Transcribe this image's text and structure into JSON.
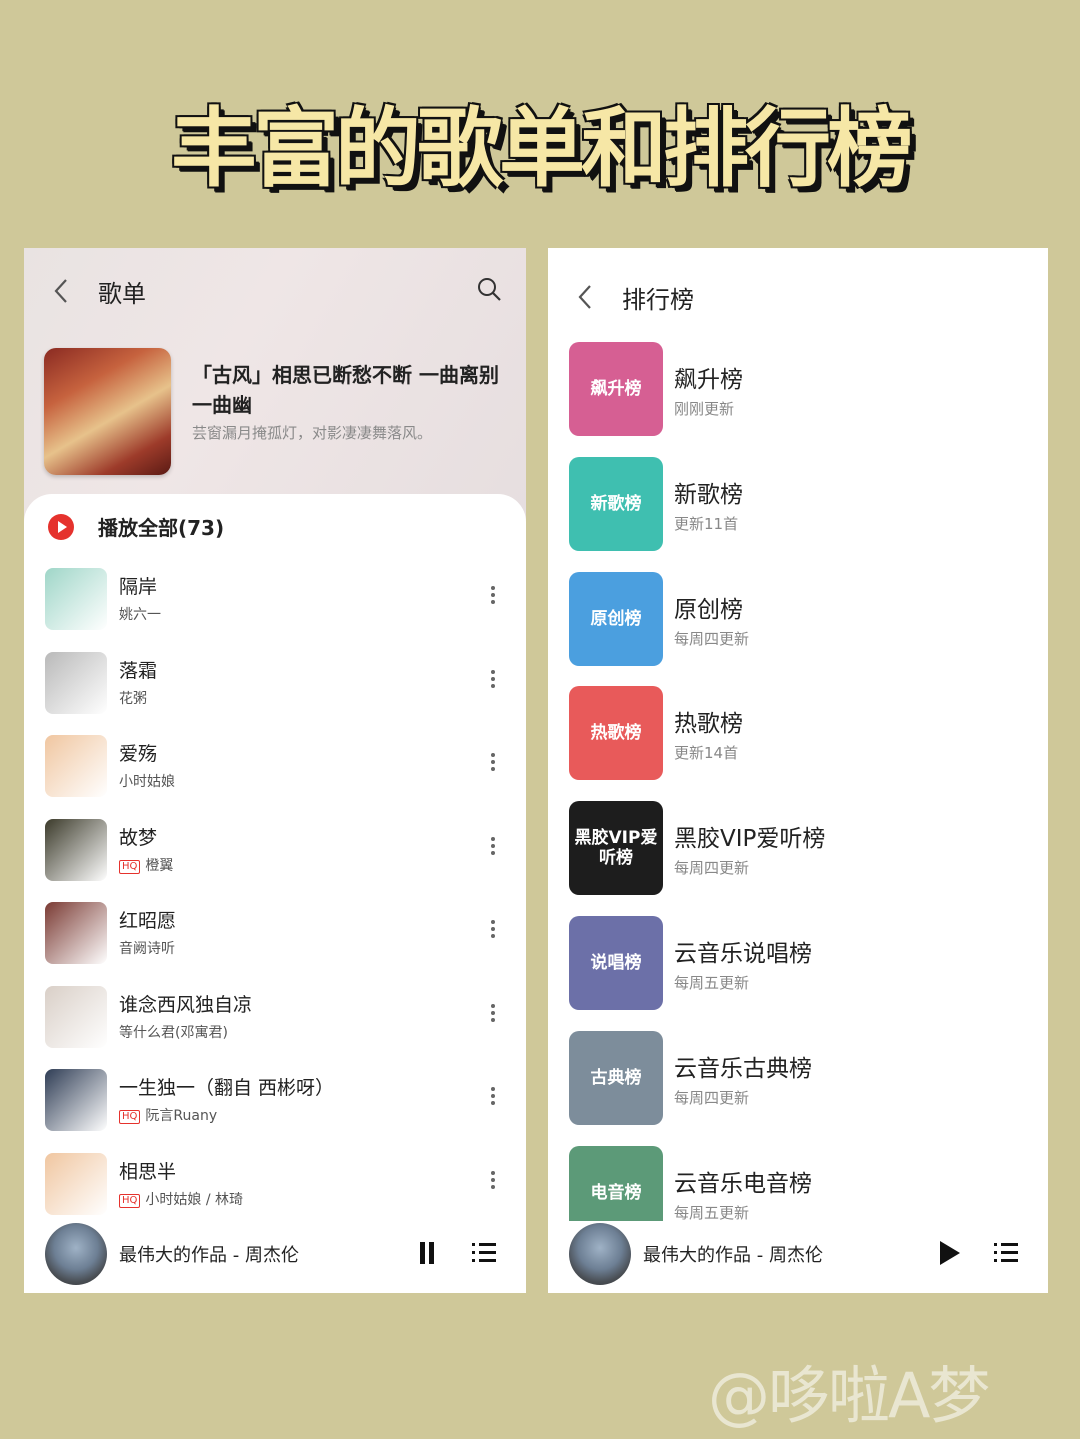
{
  "headline": "丰富的歌单和排行榜",
  "playlist_screen": {
    "title": "歌单",
    "playlist_title": "「古风」相思已断愁不断 一曲离别一曲幽",
    "playlist_desc": "芸窗漏月掩孤灯，对影凄凄舞落风。",
    "play_all": "播放全部(73)",
    "songs": [
      {
        "title": "隔岸",
        "artist": "姚六一",
        "hq": false,
        "color": "#9fd6c8"
      },
      {
        "title": "落霜",
        "artist": "花粥",
        "hq": false,
        "color": "#b9b9b9"
      },
      {
        "title": "爱殇",
        "artist": "小时姑娘",
        "hq": false,
        "color": "#f0c6a0"
      },
      {
        "title": "故梦",
        "artist": "橙翼",
        "hq": true,
        "badge": "HQ",
        "color": "#3b3a2a"
      },
      {
        "title": "红昭愿",
        "artist": "音阙诗听",
        "hq": false,
        "color": "#7a3a33"
      },
      {
        "title": "谁念西风独自凉",
        "artist": "等什么君(邓寓君)",
        "hq": false,
        "color": "#d9cfc7"
      },
      {
        "title": "一生独一（翻自 西彬呀）",
        "artist": "阮言Ruany",
        "hq": true,
        "badge": "HQ",
        "color": "#2f3d55"
      },
      {
        "title": "相思半",
        "artist": "小时姑娘 / 林琦",
        "hq": true,
        "badge": "HQ",
        "color": "#f0c6a0"
      }
    ],
    "now_playing": "最伟大的作品 - 周杰伦"
  },
  "chart_screen": {
    "title": "排行榜",
    "charts": [
      {
        "tile": "飙升榜",
        "name": "飙升榜",
        "update": "刚刚更新",
        "color": "#d65f93"
      },
      {
        "tile": "新歌榜",
        "name": "新歌榜",
        "update": "更新11首",
        "color": "#3fbfb0"
      },
      {
        "tile": "原创榜",
        "name": "原创榜",
        "update": "每周四更新",
        "color": "#4b9fdf"
      },
      {
        "tile": "热歌榜",
        "name": "热歌榜",
        "update": "更新14首",
        "color": "#e85a5a"
      },
      {
        "tile": "黑胶VIP爱听榜",
        "name": "黑胶VIP爱听榜",
        "update": "每周四更新",
        "color": "#1d1d1d"
      },
      {
        "tile": "说唱榜",
        "name": "云音乐说唱榜",
        "update": "每周五更新",
        "color": "#6c70a8"
      },
      {
        "tile": "古典榜",
        "name": "云音乐古典榜",
        "update": "每周四更新",
        "color": "#7d8d9b"
      },
      {
        "tile": "电音榜",
        "name": "云音乐电音榜",
        "update": "每周五更新",
        "color": "#5c9a78"
      }
    ],
    "now_playing": "最伟大的作品 - 周杰伦"
  },
  "watermark": "@哆啦A梦"
}
